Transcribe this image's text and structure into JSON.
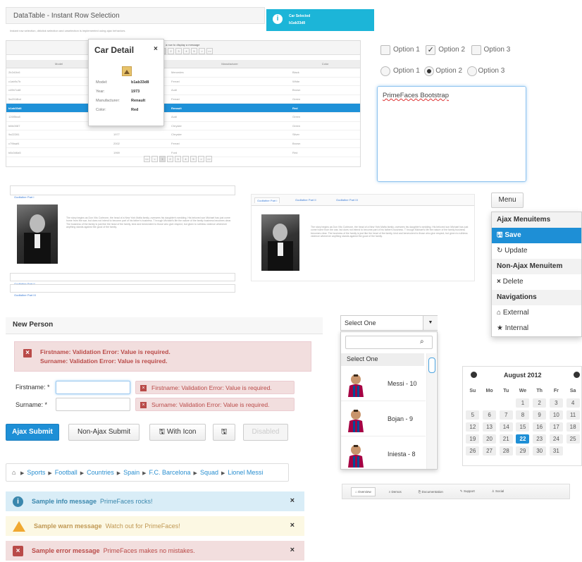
{
  "datatable": {
    "title": "DataTable - Instant Row Selection",
    "subtitle": "Instant row selection, dblclick selection and unselection is implemented using ajax behaviors.",
    "hint": "a row to display a message",
    "columns": [
      "Model",
      "Year",
      "Manufacturer",
      "Color"
    ],
    "rows": [
      [
        "2b2d1fc6",
        "",
        "Mercedes",
        "Black"
      ],
      [
        "c1ab9c7b",
        "",
        "Ferrari",
        "White"
      ],
      [
        "c49b7cd8",
        "",
        "Audi",
        "Brown"
      ],
      [
        "5a2018bd",
        "",
        "Ferrari",
        "Green"
      ],
      [
        "b1ab33d8",
        "",
        "Renault",
        "Red"
      ],
      [
        "126f5ba8",
        "",
        "Audi",
        "Green"
      ],
      [
        "b6fc0087",
        "",
        "Chrysler",
        "Green"
      ],
      [
        "9a22281",
        "1977",
        "Chrysler",
        "Silver"
      ],
      [
        "c79faaf4",
        "2002",
        "Ferrari",
        "Brown"
      ],
      [
        "b8c0d6a5",
        "1969",
        "Ford",
        "Red"
      ]
    ],
    "selected_index": 4,
    "pages": [
      "1",
      "2",
      "3",
      "4",
      "5"
    ],
    "nav": [
      "<<",
      "<",
      ">",
      ">>"
    ]
  },
  "card": {
    "title": "Car Detail",
    "close": "×",
    "fields": [
      {
        "label": "Model:",
        "value": "b1ab33d8"
      },
      {
        "label": "Year:",
        "value": "1973"
      },
      {
        "label": "Manufacturer:",
        "value": "Renault"
      },
      {
        "label": "Color:",
        "value": "Red"
      }
    ]
  },
  "growl": {
    "title": "Car Selected",
    "detail": "b1ab33d8",
    "color": "#1cb5d8"
  },
  "checkboxes": {
    "items": [
      {
        "label": "Option 1",
        "checked": false
      },
      {
        "label": "Option 2",
        "checked": true
      },
      {
        "label": "Option 3",
        "checked": false
      }
    ]
  },
  "radios": {
    "items": [
      {
        "label": "Option 1",
        "selected": false
      },
      {
        "label": "Option 2",
        "selected": true
      },
      {
        "label": "Option 3",
        "selected": false
      }
    ]
  },
  "textarea": {
    "value": "PrimeFaces Bootstrap"
  },
  "accordion": {
    "tabs": [
      "Godfather Part I",
      "Godfather Part II",
      "Godfather Part III"
    ],
    "text": "The story begins as Don Vito Corleone, the head of a New York Mafia family, oversees his daughter's wedding. His beloved son Michael has just come home from the war, but does not intend to become part of his father's business. T hrough Michael's life the nature of the family business becomes clear. The business of the family is just like the head of the family, kind and benevolent to those who give respect, but given to ruthless violence whenever anything stands against the good of the family."
  },
  "tabview": {
    "tabs": [
      "Godfather Part I",
      "Godfather Part II",
      "Godfather Part III"
    ],
    "text": "The story begins as Don Vito Corleone, the head of a New York Mafia family, oversees his daughter's wedding. His beloved son Michael has just come home from the war, but does not intend to become part of his father's business. T hrough Michael's life the nature of the family business becomes clear. The business of the family is just like the head of the family, kind and benevolent to those who give respect, but given to ruthless violence whenever anything stands against the good of the family."
  },
  "menu": {
    "button": "Menu",
    "groups": [
      {
        "header": "Ajax Menuitems",
        "items": [
          {
            "label": "Save",
            "icon": "save-icon"
          },
          {
            "label": "Update",
            "icon": "refresh-icon"
          }
        ]
      },
      {
        "header": "Non-Ajax Menuitem",
        "items": [
          {
            "label": "Delete",
            "icon": "close-icon"
          }
        ]
      },
      {
        "header": "Navigations",
        "items": [
          {
            "label": "External",
            "icon": "home-icon"
          },
          {
            "label": "Internal",
            "icon": "star-icon"
          }
        ]
      }
    ]
  },
  "form": {
    "title": "New Person",
    "errors": [
      "Firstname: Validation Error: Value is required.",
      "Surname: Validation Error: Value is required."
    ],
    "fields": [
      {
        "label": "Firstname: *",
        "message": "Firstname: Validation Error: Value is required."
      },
      {
        "label": "Surname: *",
        "message": "Surname: Validation Error: Value is required."
      }
    ]
  },
  "buttons": {
    "ajax": "Ajax Submit",
    "nonajax": "Non-Ajax Submit",
    "withicon": "With Icon",
    "disabled": "Disabled"
  },
  "breadcrumb": {
    "items": [
      "Sports",
      "Football",
      "Countries",
      "Spain",
      "F.C. Barcelona",
      "Squad",
      "Lionel Messi"
    ]
  },
  "messages": [
    {
      "severity": "info",
      "summary": "Sample info message",
      "detail": "PrimeFaces rocks!",
      "bg": "#d9edf7",
      "color": "#3a87ad"
    },
    {
      "severity": "warn",
      "summary": "Sample warn message",
      "detail": "Watch out for PrimeFaces!",
      "bg": "#fcf8e3",
      "color": "#c09853"
    },
    {
      "severity": "error",
      "summary": "Sample error message",
      "detail": "PrimeFaces makes no mistakes.",
      "bg": "#f2dede",
      "color": "#b94a48"
    }
  ],
  "selectonemenu": {
    "value": "Select One",
    "header_item": "Select One",
    "items": [
      "Messi - 10",
      "Bojan - 9",
      "Iniesta - 8"
    ]
  },
  "calendar": {
    "title": "August 2012",
    "weekdays": [
      "Su",
      "Mo",
      "Tu",
      "We",
      "Th",
      "Fr",
      "Sa"
    ],
    "weeks": [
      [
        "",
        "",
        "",
        "1",
        "2",
        "3",
        "4"
      ],
      [
        "5",
        "6",
        "7",
        "8",
        "9",
        "10",
        "11"
      ],
      [
        "12",
        "13",
        "14",
        "15",
        "16",
        "17",
        "18"
      ],
      [
        "19",
        "20",
        "21",
        "22",
        "23",
        "24",
        "25"
      ],
      [
        "26",
        "27",
        "28",
        "29",
        "30",
        "31",
        ""
      ]
    ],
    "today": "22"
  },
  "menubar": {
    "items": [
      "Overview",
      "Demos",
      "Documentation",
      "Support",
      "Social"
    ]
  }
}
